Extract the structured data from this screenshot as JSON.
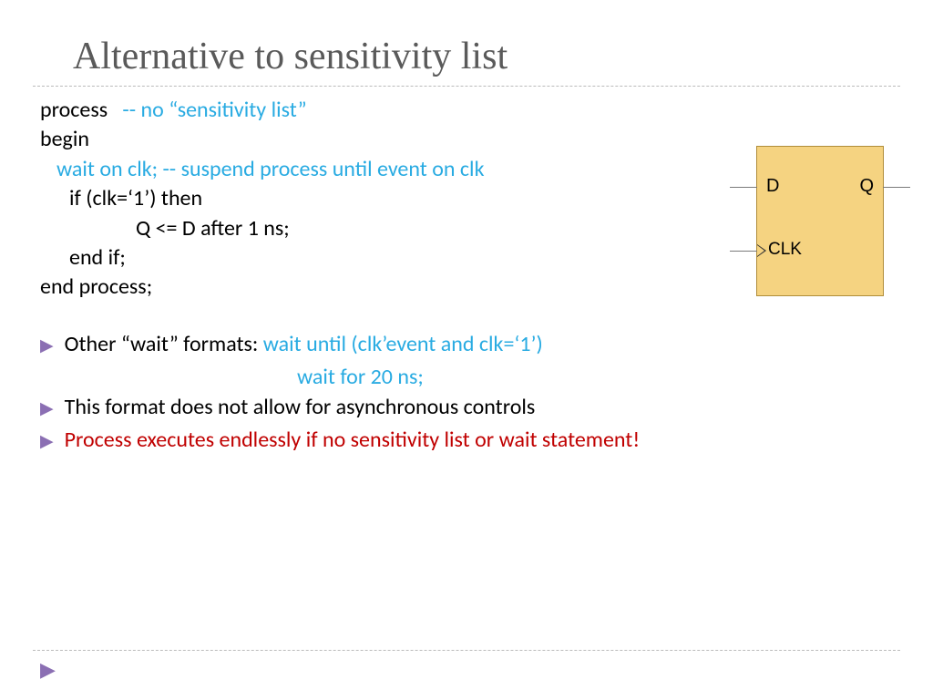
{
  "title": "Alternative to sensitivity list",
  "code": {
    "l1a": "process   ",
    "l1b": "-- no “sensitivity list”",
    "l2": "begin",
    "l3": "wait on clk; -- suspend process until event on clk",
    "l4": "if (clk=‘1’) then",
    "l5": "Q <= D after 1 ns;",
    "l6": "end if;",
    "l7": "end process;"
  },
  "bullets": {
    "b1_label": "Other “wait” formats:     ",
    "b1_code1": "wait until (clk’event and clk=‘1’)",
    "b1_code2": "wait for 20 ns;",
    "b2": "This format does not allow for asynchronous controls",
    "b3": "Process executes endlessly if no sensitivity list or wait statement!"
  },
  "diagram": {
    "d": "D",
    "q": "Q",
    "clk": "CLK"
  }
}
